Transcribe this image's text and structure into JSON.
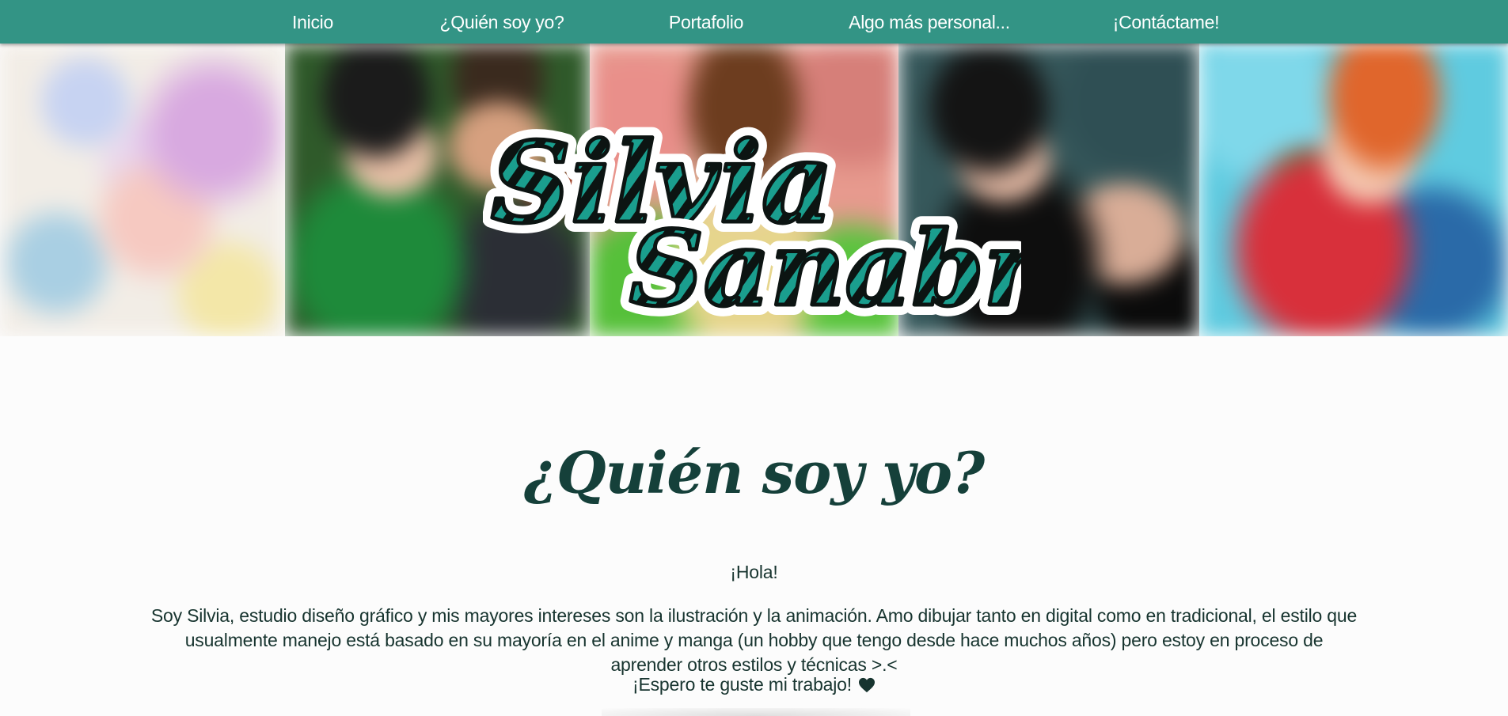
{
  "nav": {
    "items": [
      {
        "label": "Inicio"
      },
      {
        "label": "¿Quién soy yo?"
      },
      {
        "label": "Portafolio"
      },
      {
        "label": "Algo más personal..."
      },
      {
        "label": "¡Contáctame!"
      }
    ]
  },
  "banner": {
    "logo": {
      "line1": "Silvia",
      "line2": "Sanabria"
    }
  },
  "about": {
    "title": "¿Quién soy yo?",
    "greeting": "¡Hola!",
    "intro": "Soy Silvia, estudio diseño gráfico y mis mayores intereses son la ilustración y la animación. Amo dibujar tanto en digital como en tradicional, el estilo que usualmente manejo está basado en su mayoría en el anime y manga (un hobby que tengo desde hace muchos años) pero estoy en proceso de aprender otros estilos y técnicas >.<",
    "closing": "¡Espero te guste mi trabajo!",
    "closing_icon": "heart-icon"
  },
  "colors": {
    "nav_background": "#339485",
    "nav_text": "#ffffff",
    "heading": "#15403a",
    "logo_stripe_teal": "#1a9e8e",
    "logo_stripe_dark": "#0c1412",
    "body_text": "#17342f"
  }
}
